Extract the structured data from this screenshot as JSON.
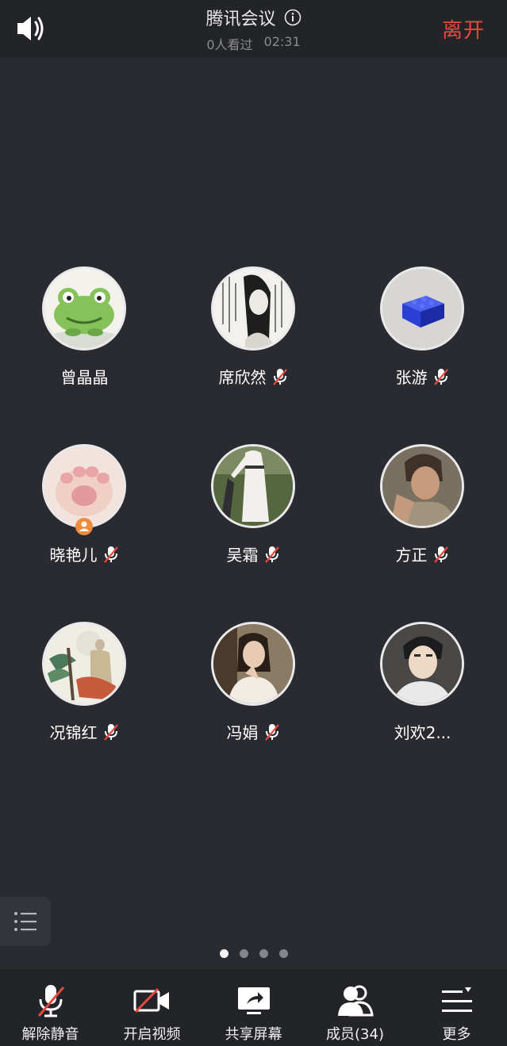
{
  "header": {
    "title": "腾讯会议",
    "viewers": "0人看过",
    "timer": "02:31",
    "leave_label": "离开"
  },
  "participants": [
    {
      "name": "曾晶晶",
      "muted": false,
      "avatar": "cartoon-frog",
      "host": false
    },
    {
      "name": "席欣然",
      "muted": true,
      "avatar": "ink-painting-girl",
      "host": false
    },
    {
      "name": "张游",
      "muted": true,
      "avatar": "blue-block",
      "host": false
    },
    {
      "name": "晓艳儿",
      "muted": true,
      "avatar": "cat-paw",
      "host": true
    },
    {
      "name": "吴霜",
      "muted": true,
      "avatar": "white-dress-woman",
      "host": false
    },
    {
      "name": "方正",
      "muted": true,
      "avatar": "man-portrait",
      "host": false
    },
    {
      "name": "况锦红",
      "muted": true,
      "avatar": "classical-painting",
      "host": false
    },
    {
      "name": "冯娟",
      "muted": true,
      "avatar": "woman-portrait",
      "host": false
    },
    {
      "name": "刘欢2...",
      "muted": false,
      "avatar": "young-man-portrait",
      "host": false
    }
  ],
  "pagination": {
    "total": 4,
    "current": 1
  },
  "toolbar": {
    "unmute_label": "解除静音",
    "video_label": "开启视频",
    "share_label": "共享屏幕",
    "members_label": "成员(34)",
    "more_label": "更多"
  },
  "colors": {
    "background": "#2a2b30",
    "bar": "#232428",
    "leave": "#e8483e",
    "mute_slash": "#e8483e",
    "host_badge": "#f08a3c"
  }
}
